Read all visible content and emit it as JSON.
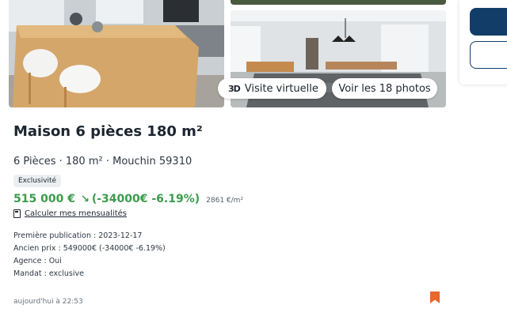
{
  "gallery": {
    "virtual_tour_icon": "3D",
    "virtual_tour_label": "Visite virtuelle",
    "photos_label": "Voir les 18 photos"
  },
  "listing": {
    "title": "Maison 6 pièces 180 m²",
    "subtitle": "6 Pièces · 180 m² · Mouchin 59310",
    "badge": "Exclusivité",
    "price": "515 000 €",
    "trend_icon": "↘",
    "price_change": "(-34000€ -6.19%)",
    "price_per_m2": "2861 €/m²",
    "calc_link": "Calculer mes mensualités",
    "details": [
      "Première publication : 2023-12-17",
      "Ancien prix : 549000€ (-34000€ -6.19%)",
      "Agence : Oui",
      "Mandat : exclusive"
    ],
    "timestamp": "aujourd'hui à 22:53"
  },
  "colors": {
    "price_green": "#3b9b4b",
    "primary_navy": "#123d69",
    "bookmark_orange": "#e8672a"
  },
  "icons": {
    "virtual_tour": "3d-tour-icon",
    "calculator": "calculator-icon",
    "price_trend": "trend-down-icon",
    "bookmark": "bookmark-icon"
  }
}
